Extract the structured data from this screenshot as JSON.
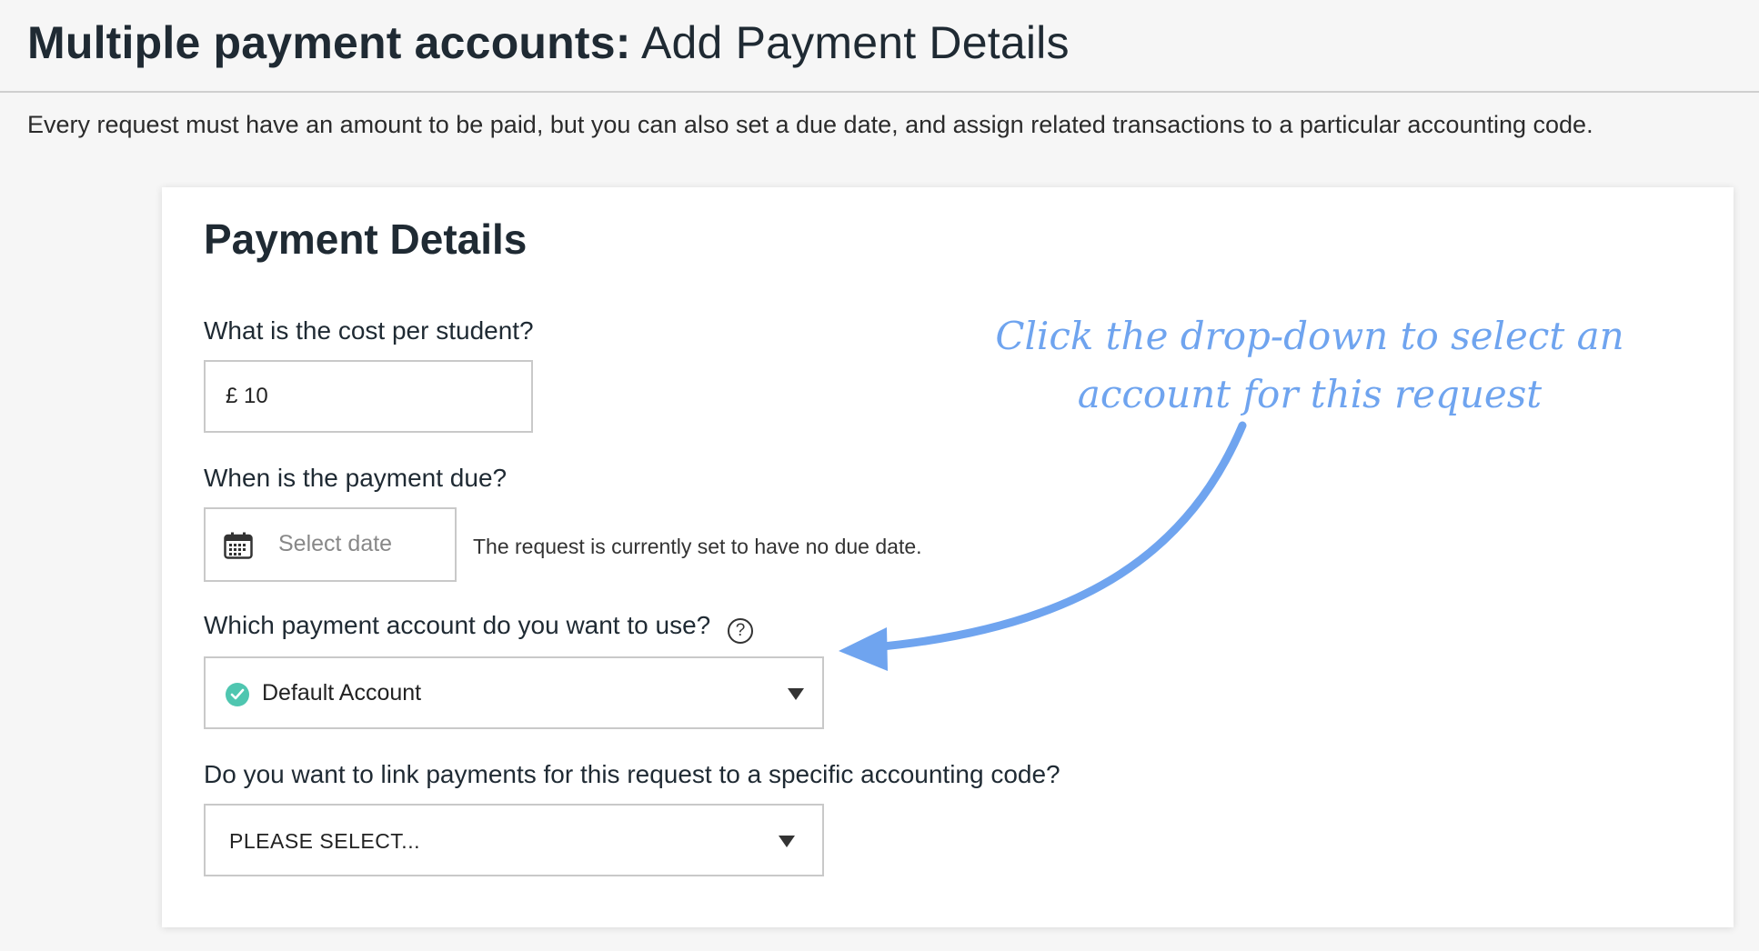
{
  "header": {
    "title_strong": "Multiple payment accounts:",
    "title_rest": " Add Payment Details",
    "intro": "Every request must have an amount to be paid, but you can also set a due date, and assign related transactions to a particular accounting code."
  },
  "card": {
    "title": "Payment Details",
    "cost": {
      "label": "What is the cost per student?",
      "value": "£ 10"
    },
    "due": {
      "label": "When is the payment due?",
      "placeholder": "Select date",
      "note": "The request is currently set to have no due date.",
      "icon": "calendar-icon"
    },
    "account": {
      "label": "Which payment account do you want to use?",
      "help_glyph": "?",
      "selected": "Default Account",
      "status_color": "#4fc6b0"
    },
    "code": {
      "label": "Do you want to link payments for this request to a specific accounting code?",
      "selected": "PLEASE SELECT..."
    }
  },
  "annotation": {
    "line1": "Click the drop-down to select an",
    "line2": "account for this request",
    "color": "#6fa4ef"
  }
}
